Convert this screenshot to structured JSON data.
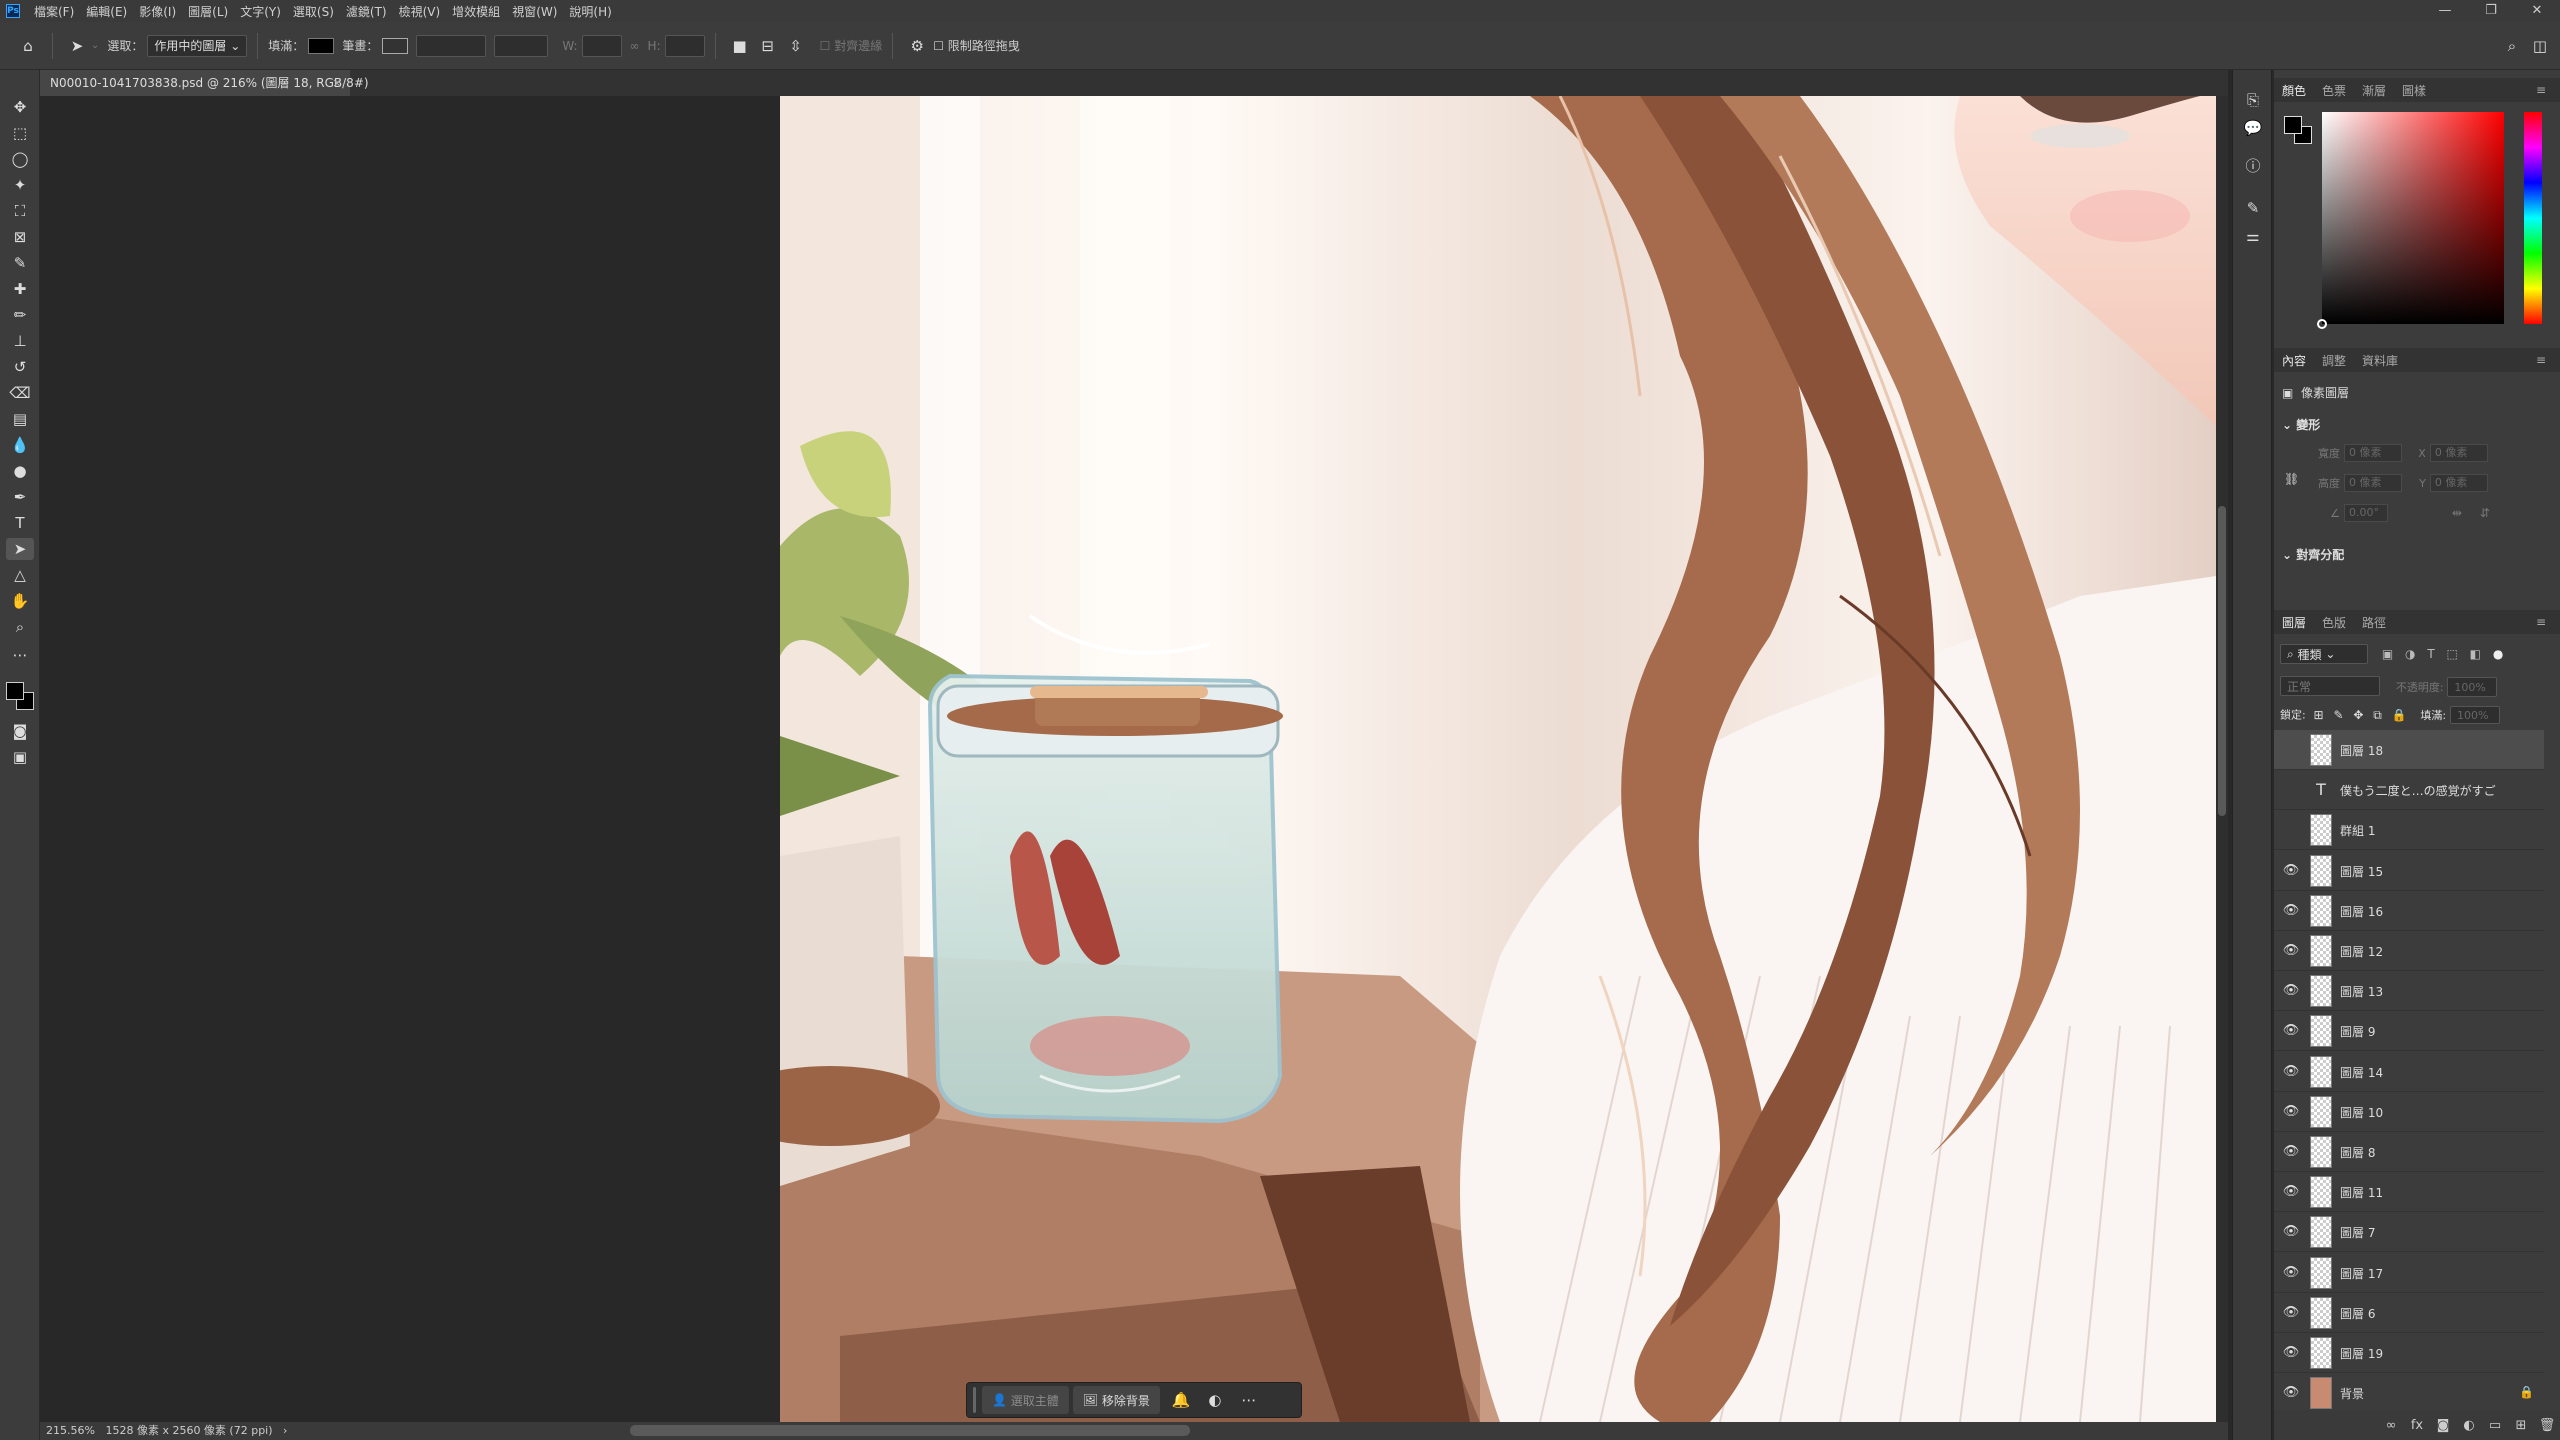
{
  "app": {
    "logo": "Ps",
    "colors": {
      "accent": "#31a8ff",
      "panel": "#3c3c3c",
      "canvas_bg": "#282828"
    }
  },
  "menu": [
    "檔案(F)",
    "編輯(E)",
    "影像(I)",
    "圖層(L)",
    "文字(Y)",
    "選取(S)",
    "濾鏡(T)",
    "檢視(V)",
    "增效模組",
    "視窗(W)",
    "說明(H)"
  ],
  "window_controls": {
    "minimize": "—",
    "maximize": "❐",
    "close": "✕"
  },
  "options": {
    "select_label": "選取：",
    "select_value": "作用中的圖層",
    "fill_label": "填滿：",
    "stroke_label": "筆畫：",
    "w_label": "W:",
    "h_label": "H:",
    "align_edges": "對齊邊緣",
    "constrain_path": "限制路徑拖曳"
  },
  "document_tab": {
    "title": "N00010-1041703838.psd @ 216% (圖層 18, RGB/8#)",
    "close": "×"
  },
  "context_bar": {
    "select_subject": "選取主體",
    "remove_bg": "移除背景",
    "more": "⋯"
  },
  "status": {
    "zoom": "215.56%",
    "info": "1528 像素 x 2560 像素 (72 ppi)",
    "arrow": "›"
  },
  "color_panel": {
    "tabs": [
      "顏色",
      "色票",
      "漸層",
      "圖樣"
    ]
  },
  "properties_panel": {
    "tabs": [
      "內容",
      "調整",
      "資料庫"
    ],
    "kind": "像素圖層",
    "transform_title": "變形",
    "w_label": "寬度",
    "h_label": "高度",
    "w_value": "0 像素",
    "h_value": "0 像素",
    "x_label": "X",
    "y_label": "Y",
    "x_value": "0 像素",
    "y_value": "0 像素",
    "angle_value": "0.00°",
    "align_title": "對齊分配"
  },
  "layers_panel": {
    "tabs": [
      "圖層",
      "色版",
      "路徑"
    ],
    "filter_kind": "種類",
    "blend_mode": "正常",
    "opacity_label": "不透明度:",
    "opacity_value": "100%",
    "lock_label": "鎖定:",
    "fill_label": "填滿:",
    "fill_value": "100%",
    "layers": [
      {
        "name": "圖層 18",
        "kind": "pixel",
        "visible": false,
        "selected": true
      },
      {
        "name": "僕もう二度と…の感覚がすご",
        "kind": "text",
        "visible": false,
        "selected": false
      },
      {
        "name": "群組 1",
        "kind": "group",
        "visible": false,
        "selected": false
      },
      {
        "name": "圖層 15",
        "kind": "pixel",
        "visible": true,
        "selected": false
      },
      {
        "name": "圖層 16",
        "kind": "pixel",
        "visible": true,
        "selected": false
      },
      {
        "name": "圖層 12",
        "kind": "pixel",
        "visible": true,
        "selected": false
      },
      {
        "name": "圖層 13",
        "kind": "pixel",
        "visible": true,
        "selected": false
      },
      {
        "name": "圖層 9",
        "kind": "pixel",
        "visible": true,
        "selected": false
      },
      {
        "name": "圖層 14",
        "kind": "pixel",
        "visible": true,
        "selected": false
      },
      {
        "name": "圖層 10",
        "kind": "pixel",
        "visible": true,
        "selected": false
      },
      {
        "name": "圖層 8",
        "kind": "pixel",
        "visible": true,
        "selected": false
      },
      {
        "name": "圖層 11",
        "kind": "pixel",
        "visible": true,
        "selected": false
      },
      {
        "name": "圖層 7",
        "kind": "pixel",
        "visible": true,
        "selected": false
      },
      {
        "name": "圖層 17",
        "kind": "pixel",
        "visible": true,
        "selected": false
      },
      {
        "name": "圖層 6",
        "kind": "pixel",
        "visible": true,
        "selected": false
      },
      {
        "name": "圖層 19",
        "kind": "pixel",
        "visible": true,
        "selected": false
      },
      {
        "name": "背景",
        "kind": "background",
        "visible": true,
        "selected": false
      }
    ]
  }
}
